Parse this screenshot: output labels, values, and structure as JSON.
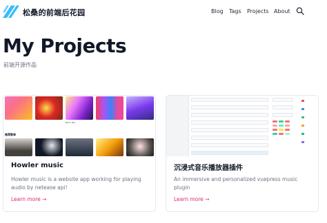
{
  "site": {
    "title": "松桑的前端后花园",
    "logo_icon": "striped-logo-icon",
    "accent_color": "#38bdf8"
  },
  "nav": {
    "blog": "Blog",
    "tags": "Tags",
    "projects": "Projects",
    "about": "About",
    "search_icon": "search-icon",
    "theme_icon": "moon-icon"
  },
  "page": {
    "title": "My Projects",
    "subtitle": "前端开源作品"
  },
  "projects": [
    {
      "title": "Howler music",
      "description": "Howler music is a website app working for playing audio by netease api!",
      "link": "Learn more →",
      "thumbnail": {
        "section_label": "推荐歌单",
        "album_captions": [
          "",
          "",
          "Neon Pop",
          "",
          ""
        ]
      }
    },
    {
      "title": "沉浸式音乐播放器插件",
      "description": "An immersive and personalized vuepress music plugin",
      "link": "Learn more →"
    }
  ],
  "colors": {
    "link": "#db2777",
    "text": "#111827",
    "muted": "#6b7280",
    "border": "#e5e7eb"
  }
}
